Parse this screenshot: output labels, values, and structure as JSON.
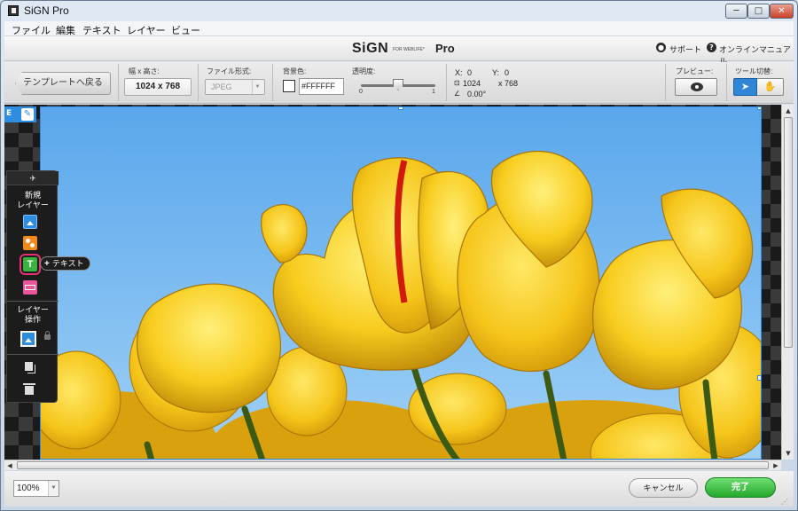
{
  "window": {
    "title": "SiGN Pro",
    "min_label": "─",
    "max_label": "□",
    "close_label": "✕"
  },
  "menu": [
    "ファイル",
    "編集",
    "テキスト",
    "レイヤー",
    "ビュー"
  ],
  "brand": {
    "logo": "SiGN",
    "logo_sub": "FOR WEBLIFE*",
    "logo_pro": "Pro"
  },
  "header_links": {
    "support": "サポート",
    "manual": "オンラインマニュアル",
    "support_icon": "person-icon",
    "manual_icon": "question-icon"
  },
  "toolbar": {
    "template_back": "テンプレートへ戻る",
    "size_label": "幅 x 高さ:",
    "size_value": "1024 x 768",
    "format_label": "ファイル形式:",
    "format_value": "JPEG",
    "bg_label": "背景色:",
    "bg_value": "#FFFFFF",
    "opacity_label": "透明度:",
    "opacity_min": "0",
    "opacity_max": "1",
    "opacity_level": 0.5,
    "x_label": "X:",
    "x_value": "0",
    "y_label": "Y:",
    "y_value": "0",
    "w_value": "1024",
    "h_value": "x 768",
    "angle_value": "0.00°",
    "preview_label": "プレビュー:",
    "tool_label": "ツール切替:",
    "tool_select_icon": "cursor-icon",
    "tool_hand_icon": "hand-icon"
  },
  "edit_tab": {
    "label": "E"
  },
  "layer_panel": {
    "new_layer_label": "新規\nレイヤー",
    "layer_ops_label": "レイヤー\n操作",
    "text_button_letter": "T"
  },
  "tooltip": {
    "plus": "+",
    "text": "テキスト"
  },
  "bottom": {
    "zoom": "100%",
    "cancel": "キャンセル",
    "done": "完了"
  },
  "colors": {
    "accent_blue": "#2e8de0",
    "done_green": "#25a82c",
    "highlight_pink": "#e2336d"
  }
}
